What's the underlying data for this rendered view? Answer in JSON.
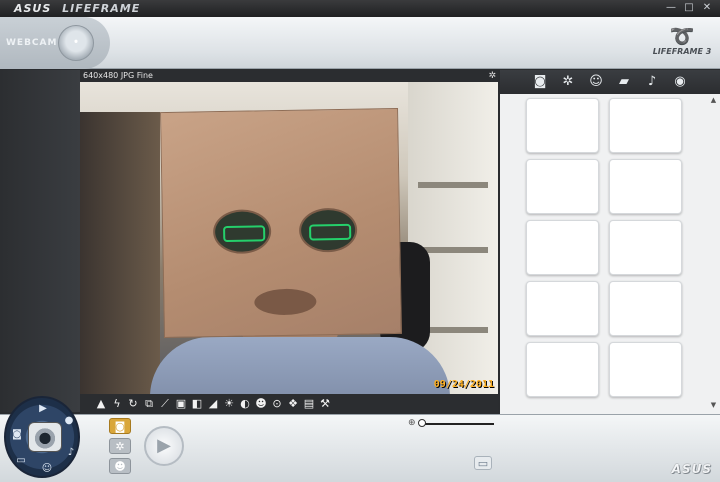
{
  "window": {
    "brand": "ASUS",
    "app_name": "LIFEFRAME",
    "min_glyph": "—",
    "max_glyph": "□",
    "close_glyph": "✕"
  },
  "top": {
    "webcam_label": "WEBCAM",
    "logo_name": "LIFEFRAME 3"
  },
  "preview": {
    "resolution_label": "640x480 JPG Fine",
    "date_stamp": "09/24/2011"
  },
  "toolbar": {
    "tools": [
      {
        "icon": "scene-icon",
        "glyph": "▲"
      },
      {
        "icon": "flash-icon",
        "glyph": "ϟ"
      },
      {
        "icon": "timer-icon",
        "glyph": "↻"
      },
      {
        "icon": "burst-icon",
        "glyph": "⧉"
      },
      {
        "icon": "ruler-icon",
        "glyph": "⟋"
      },
      {
        "icon": "frame-icon",
        "glyph": "▣"
      },
      {
        "icon": "split-icon",
        "glyph": "◧"
      },
      {
        "icon": "exposure-icon",
        "glyph": "◢"
      },
      {
        "icon": "brightness-icon",
        "glyph": "☀"
      },
      {
        "icon": "contrast-icon",
        "glyph": "◐"
      },
      {
        "icon": "face-icon",
        "glyph": "☻"
      },
      {
        "icon": "effect-icon",
        "glyph": "⊙"
      },
      {
        "icon": "color-icon",
        "glyph": "❖"
      },
      {
        "icon": "picture-icon",
        "glyph": "▤"
      },
      {
        "icon": "wrench-icon",
        "glyph": "⚒"
      }
    ]
  },
  "right_tabs": [
    {
      "icon": "camera-icon",
      "glyph": "◙"
    },
    {
      "icon": "gear-icon",
      "glyph": "✲"
    },
    {
      "icon": "head-icon",
      "glyph": "☺"
    },
    {
      "icon": "video-icon",
      "glyph": "▰"
    },
    {
      "icon": "microphone-icon",
      "glyph": "♪"
    },
    {
      "icon": "eye-icon",
      "glyph": "◉"
    }
  ],
  "thumbnails_count": 10,
  "bottom": {
    "brand": "ASUS",
    "shutter_glyph": "▶",
    "zoom_glyph": "⊕",
    "modes": [
      {
        "icon": "photo-mode-icon",
        "glyph": "◙",
        "active": true
      },
      {
        "icon": "settings-mode-icon",
        "glyph": "✲",
        "active": false
      },
      {
        "icon": "face-mode-icon",
        "glyph": "☻",
        "active": false
      }
    ],
    "dial_icons": [
      {
        "icon": "dial-photo-icon",
        "glyph": "◙"
      },
      {
        "icon": "dial-video-icon",
        "glyph": "▶"
      },
      {
        "icon": "dial-record-icon",
        "glyph": "●"
      },
      {
        "icon": "dial-mic-icon",
        "glyph": "♪"
      },
      {
        "icon": "dial-face-icon",
        "glyph": "☺"
      },
      {
        "icon": "dial-screen-icon",
        "glyph": "▭"
      }
    ],
    "folder_glyph": "▭"
  },
  "colors": {
    "accent": "#d9a63a",
    "dark_chrome": "#2b2d30",
    "date_stamp": "#ffb020"
  }
}
